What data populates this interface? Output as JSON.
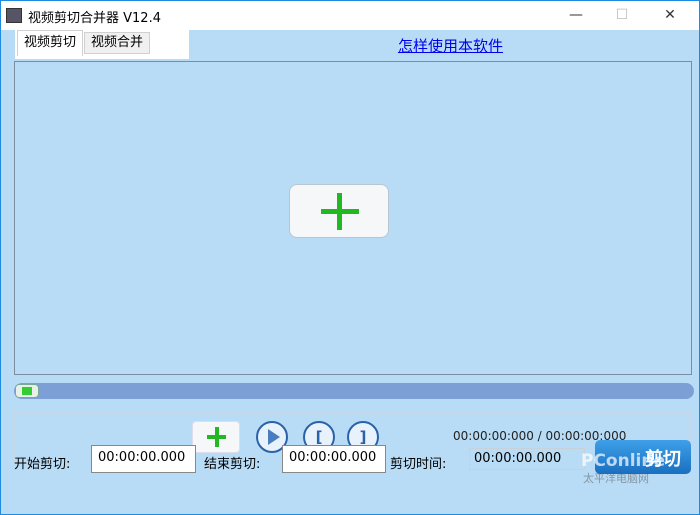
{
  "window": {
    "title": "视频剪切合并器 V12.4",
    "minimize": "—",
    "maximize": "☐",
    "close": "✕"
  },
  "tabs": [
    {
      "label": "视频剪切",
      "active": true
    },
    {
      "label": "视频合并",
      "active": false
    }
  ],
  "help_link": "怎样使用本软件",
  "seek": {
    "position_percent": 0
  },
  "controls": {
    "time_display": "00:00:00:000 / 00:00:00:000",
    "start_mark": "[",
    "end_mark": "]"
  },
  "cut": {
    "start_label": "开始剪切:",
    "start_value": "00:00:00.000",
    "end_label": "结束剪切:",
    "end_value": "00:00:00.000",
    "duration_label": "剪切时间:",
    "duration_value": "00:00:00.000",
    "cut_button": "剪切"
  },
  "watermark": {
    "text": "PConline",
    "subtext": "太平洋电脑网"
  }
}
